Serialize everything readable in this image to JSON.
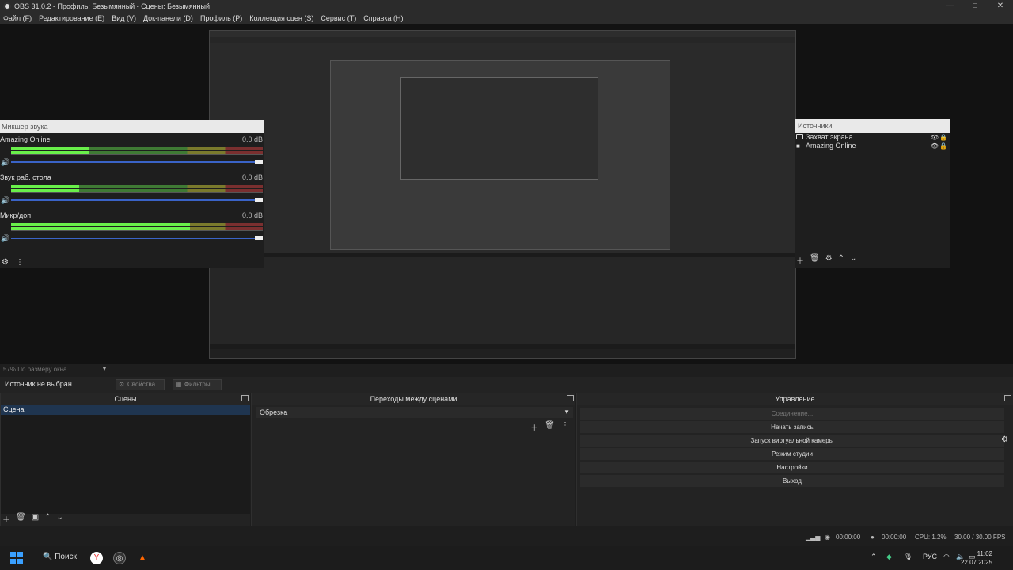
{
  "window": {
    "title": "OBS 31.0.2 - Профиль: Безымянный - Сцены: Безымянный",
    "minimize": "—",
    "maximize": "□",
    "close": "✕"
  },
  "menu": [
    "Файл (F)",
    "Редактирование (E)",
    "Вид (V)",
    "Док-панели (D)",
    "Профиль (P)",
    "Коллекция сцен (S)",
    "Сервис (T)",
    "Справка (H)"
  ],
  "mixer": {
    "title": "Микшер звука",
    "channels": [
      {
        "name": "Amazing Online",
        "db": "0.0 dB",
        "level": 0.31
      },
      {
        "name": "Звук раб. стола",
        "db": "0.0 dB",
        "level": 0.27
      },
      {
        "name": "Микр/доп",
        "db": "0.0 dB",
        "level": 0.71
      }
    ]
  },
  "sources": {
    "title": "Источники",
    "items": [
      "Захват экрана",
      "Amazing Online"
    ]
  },
  "preview": {
    "zoom_label": "57% По размеру окна",
    "no_source": "Источник не выбран",
    "properties": "Свойства",
    "filters": "Фильтры"
  },
  "scenes": {
    "title": "Сцены",
    "items": [
      "Сцена"
    ]
  },
  "transitions": {
    "title": "Переходы между сценами",
    "selected": "Обрезка"
  },
  "controls": {
    "title": "Управление",
    "connecting": "Соединение...",
    "start_recording": "Начать запись",
    "virtual_camera": "Запуск виртуальной камеры",
    "studio_mode": "Режим студии",
    "settings": "Настройки",
    "exit": "Выход"
  },
  "status": {
    "stream_time": "00:00:00",
    "rec_time": "00:00:00",
    "cpu": "CPU: 1.2%",
    "fps": "30.00 / 30.00 FPS"
  },
  "taskbar": {
    "search": "Поиск",
    "lang": "РУС",
    "time": "11:02",
    "date": "22.07.2025"
  }
}
